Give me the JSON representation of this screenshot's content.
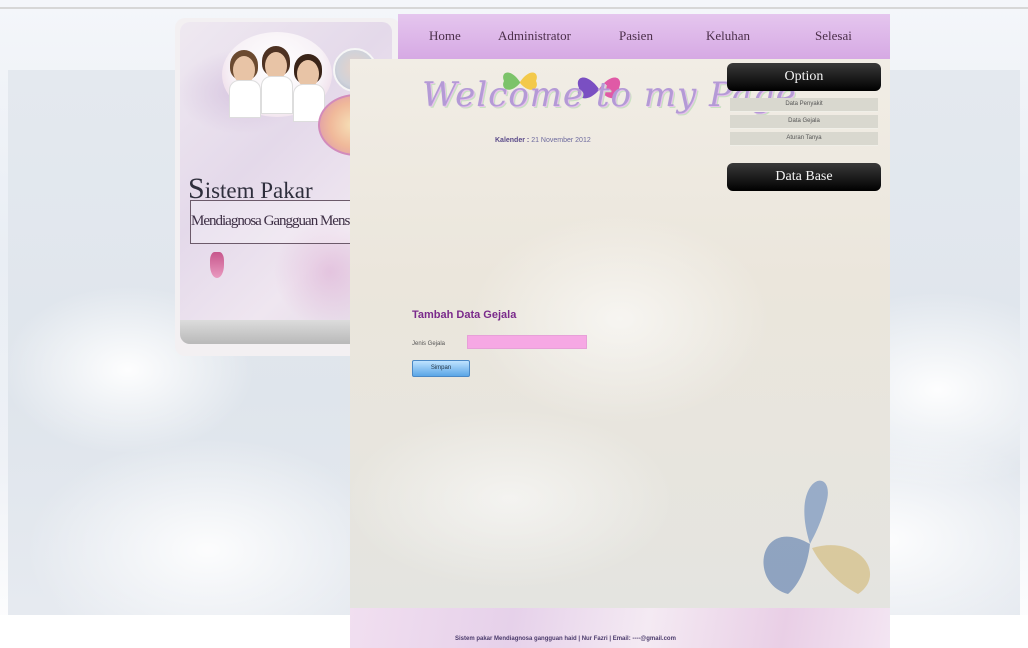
{
  "nav": {
    "items": [
      "Home",
      "Administrator",
      "Pasien",
      "Keluhan",
      "Selesai"
    ]
  },
  "banner": {
    "title_first": "S",
    "title_rest": "istem Pakar",
    "subtitle": "Mendiagnosa Gangguan Menstruasi Haid"
  },
  "welcome": {
    "text": "Welcome to my Page...",
    "date_label": "Kalender :",
    "date_value": "21 November 2012"
  },
  "option": {
    "header": "Option",
    "items": [
      "Data Penyakit",
      "Data Gejala",
      "Aturan Tanya"
    ]
  },
  "database": {
    "header": "Data Base"
  },
  "form": {
    "title": "Tambah Data Gejala",
    "label": "Jenis Gejala",
    "input_value": "",
    "submit_label": "Simpan"
  },
  "footer": {
    "text": "Sistem pakar Mendiagnosa gangguan haid | Nur Fazri | Email: ----@gmail.com"
  },
  "colors": {
    "nav_bg": "#d9b0e6",
    "form_title": "#7a2a8b",
    "input_bg": "#f6a8e4",
    "button": "#5aa6e6"
  }
}
